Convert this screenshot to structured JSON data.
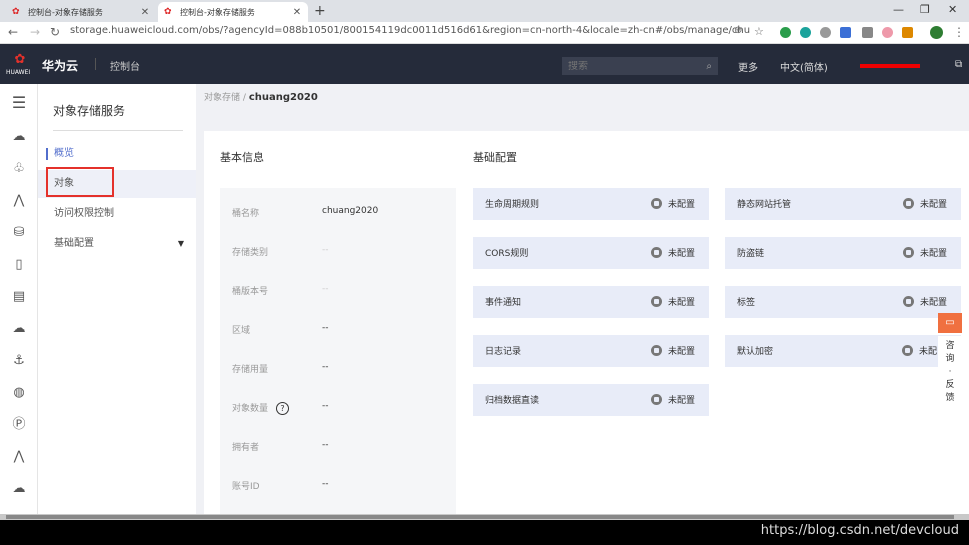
{
  "browser": {
    "tabs": [
      {
        "title": "控制台-对象存储服务",
        "active": false
      },
      {
        "title": "控制台-对象存储服务",
        "active": true
      }
    ],
    "url": "storage.huaweicloud.com/obs/?agencyId=088b10501/800154119dc0011d516d61&region=cn-north-4&locale=zh-cn#/obs/manage/chuang2020/su..."
  },
  "header": {
    "logo_text": "HUAWEI",
    "brand": "华为云",
    "console": "控制台",
    "search_placeholder": "搜索",
    "more": "更多",
    "language": "中文(简体)"
  },
  "sidebar": {
    "title": "对象存储服务",
    "items": [
      {
        "label": "概览",
        "selected": true
      },
      {
        "label": "对象",
        "highlighted": true
      },
      {
        "label": "访问权限控制"
      },
      {
        "label": "基础配置",
        "expandable": true
      }
    ]
  },
  "breadcrumb": {
    "parent": "对象存储",
    "separator": "/",
    "current": "chuang2020"
  },
  "basic_info": {
    "heading": "基本信息",
    "rows": [
      {
        "key": "桶名称",
        "value": "chuang2020"
      },
      {
        "key": "存储类别",
        "value": "--"
      },
      {
        "key": "桶版本号",
        "value": "--"
      },
      {
        "key": "区域",
        "value": "--"
      },
      {
        "key": "存储用量",
        "value": "--"
      },
      {
        "key": "对象数量",
        "value": "--",
        "help": "?"
      },
      {
        "key": "拥有者",
        "value": "--"
      },
      {
        "key": "账号ID",
        "value": "--"
      }
    ]
  },
  "basic_config": {
    "heading": "基础配置",
    "items": [
      {
        "label": "生命周期规则",
        "status": "未配置"
      },
      {
        "label": "静态网站托管",
        "status": "未配置"
      },
      {
        "label": "CORS规则",
        "status": "未配置"
      },
      {
        "label": "防盗链",
        "status": "未配置"
      },
      {
        "label": "事件通知",
        "status": "未配置"
      },
      {
        "label": "标签",
        "status": "未配置"
      },
      {
        "label": "日志记录",
        "status": "未配置"
      },
      {
        "label": "默认加密",
        "status": "未配"
      },
      {
        "label": "归档数据直读",
        "status": "未配置"
      }
    ]
  },
  "consult": {
    "icon": "chat-icon",
    "text": "咨\n询\n·\n反\n馈"
  },
  "watermark": "https://blog.csdn.net/devcloud",
  "colors": {
    "header_bg": "#252b3a",
    "accent": "#526ecc",
    "highlight_box": "#e4312b",
    "config_bg": "#e8ecf8"
  }
}
